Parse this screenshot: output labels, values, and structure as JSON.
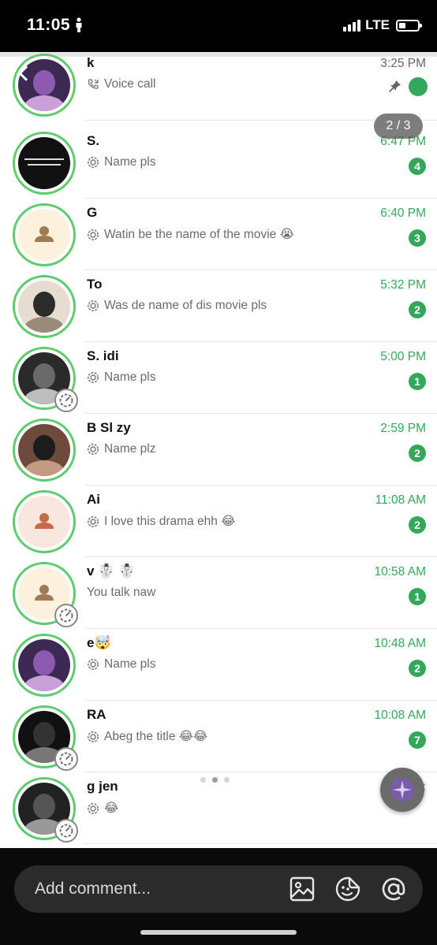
{
  "status_bar": {
    "time": "11:05",
    "network": "LTE"
  },
  "screenshot": {
    "page_indicator": "2 / 3",
    "chats": [
      {
        "name": "k",
        "preview": "Voice call",
        "preview_icon": "phone-icon",
        "time": "3:25 PM",
        "unread": "",
        "pinned": true,
        "avatar": "photo"
      },
      {
        "name": "S.",
        "preview": "Name pls",
        "preview_icon": "status-reply-icon",
        "time": "6:47 PM",
        "unread": "4",
        "pinned": false,
        "avatar": "text-photo"
      },
      {
        "name": "G",
        "preview": "Watin be the name of the movie 😭",
        "preview_icon": "status-reply-icon",
        "time": "6:40 PM",
        "unread": "3",
        "pinned": false,
        "avatar": "default-yellow"
      },
      {
        "name": "To",
        "preview": "Was de name of dis movie pls",
        "preview_icon": "status-reply-icon",
        "time": "5:32 PM",
        "unread": "2",
        "pinned": false,
        "avatar": "photo"
      },
      {
        "name": "S.      idi",
        "preview": "Name pls",
        "preview_icon": "status-reply-icon",
        "time": "5:00 PM",
        "unread": "1",
        "pinned": false,
        "avatar": "photo"
      },
      {
        "name": "B      Sl      zy",
        "preview": "Name plz",
        "preview_icon": "status-reply-icon",
        "time": "2:59 PM",
        "unread": "2",
        "pinned": false,
        "avatar": "photo"
      },
      {
        "name": "Ai",
        "preview": "I love this drama ehh 😂",
        "preview_icon": "status-reply-icon",
        "time": "11:08 AM",
        "unread": "2",
        "pinned": false,
        "avatar": "default-pink"
      },
      {
        "name": "v      ☃️ ☃️",
        "preview": "You talk naw",
        "preview_icon": "",
        "time": "10:58 AM",
        "unread": "1",
        "pinned": false,
        "avatar": "default-yellow"
      },
      {
        "name": "e🤯",
        "preview": "Name pls",
        "preview_icon": "status-reply-icon",
        "time": "10:48 AM",
        "unread": "2",
        "pinned": false,
        "avatar": "photo"
      },
      {
        "name": "RA",
        "preview": "Abeg the title 😂😂",
        "preview_icon": "status-reply-icon",
        "time": "10:08 AM",
        "unread": "7",
        "pinned": false,
        "avatar": "photo"
      },
      {
        "name": "g  jen",
        "preview": "😂",
        "preview_icon": "status-reply-icon",
        "time": "10:",
        "unread": "",
        "pinned": false,
        "avatar": "photo"
      }
    ]
  },
  "bottom_bar": {
    "comment_placeholder": "Add comment...",
    "icons": [
      "image-icon",
      "sticker-icon",
      "mention-icon"
    ]
  },
  "colors": {
    "accent": "#33a85a",
    "ring": "#5dcc6d",
    "background": "#ffffff",
    "bar": "#0a0a0a"
  }
}
